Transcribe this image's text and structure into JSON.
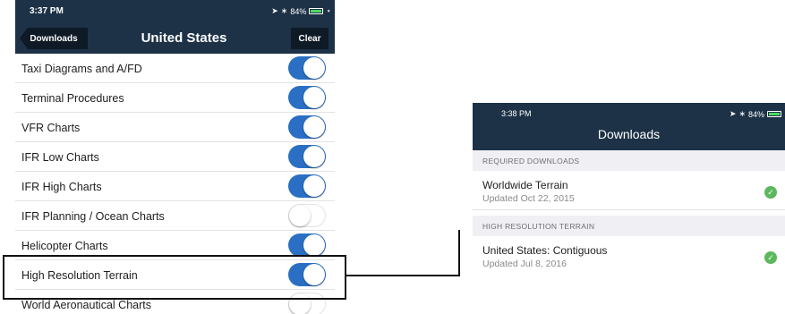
{
  "left_screen": {
    "status": {
      "time": "3:37 PM",
      "battery": "84%",
      "battery_fraction": 0.84
    },
    "nav": {
      "back_label": "Downloads",
      "title": "United States",
      "clear_label": "Clear"
    },
    "rows": [
      {
        "label": "Taxi Diagrams and A/FD",
        "enabled": true
      },
      {
        "label": "Terminal Procedures",
        "enabled": true
      },
      {
        "label": "VFR Charts",
        "enabled": true
      },
      {
        "label": "IFR Low Charts",
        "enabled": true
      },
      {
        "label": "IFR High Charts",
        "enabled": true
      },
      {
        "label": "IFR Planning / Ocean Charts",
        "enabled": false
      },
      {
        "label": "Helicopter Charts",
        "enabled": true
      },
      {
        "label": "High Resolution Terrain",
        "enabled": true
      },
      {
        "label": "World Aeronautical Charts",
        "enabled": false
      }
    ]
  },
  "right_screen": {
    "status": {
      "time": "3:38 PM",
      "battery": "84%",
      "battery_fraction": 0.84
    },
    "title": "Downloads",
    "sections": [
      {
        "header": "REQUIRED DOWNLOADS",
        "item": {
          "title": "Worldwide Terrain",
          "subtitle": "Updated Oct 22, 2015",
          "status_icon": "check-circle-icon"
        }
      },
      {
        "header": "HIGH RESOLUTION TERRAIN",
        "item": {
          "title": "United States: Contiguous",
          "subtitle": "Updated Jul 8, 2016",
          "status_icon": "check-circle-icon"
        }
      }
    ]
  },
  "colors": {
    "navbar": "#1d3247",
    "toggle_on": "#2a6fc4",
    "check": "#5cb85c",
    "battery_fill": "#4cd964"
  }
}
